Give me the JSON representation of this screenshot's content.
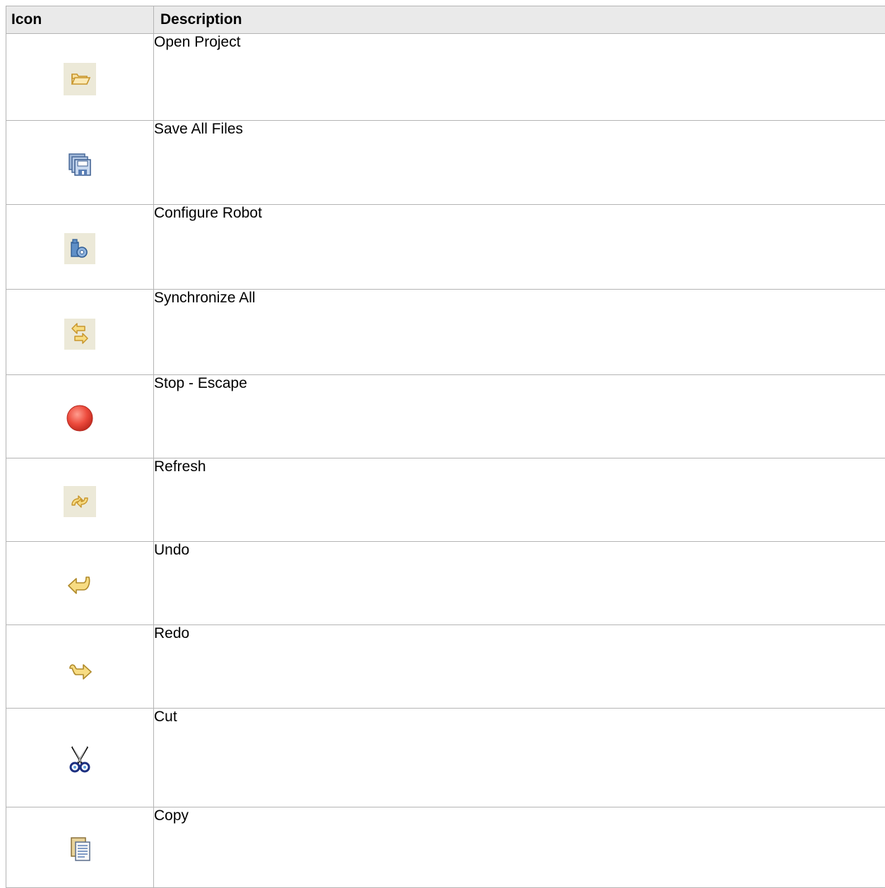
{
  "table": {
    "headers": {
      "icon": "Icon",
      "description": "Description"
    },
    "rows": [
      {
        "icon": "open-folder-icon",
        "description": "Open Project"
      },
      {
        "icon": "save-all-icon",
        "description": "Save All Files"
      },
      {
        "icon": "configure-robot-icon",
        "description": "Configure Robot"
      },
      {
        "icon": "synchronize-icon",
        "description": "Synchronize All"
      },
      {
        "icon": "stop-icon",
        "description": "Stop - Escape"
      },
      {
        "icon": "refresh-icon",
        "description": "Refresh"
      },
      {
        "icon": "undo-icon",
        "description": "Undo"
      },
      {
        "icon": "redo-icon",
        "description": "Redo"
      },
      {
        "icon": "scissors-icon",
        "description": "Cut"
      },
      {
        "icon": "copy-icon",
        "description": "Copy"
      }
    ]
  },
  "colors": {
    "header_bg": "#eaeaea",
    "border": "#b4b4b4",
    "icon_button_bg": "#ece9d8",
    "stop_red": "#e8463a",
    "arrow_yellow": "#f3cf55"
  }
}
